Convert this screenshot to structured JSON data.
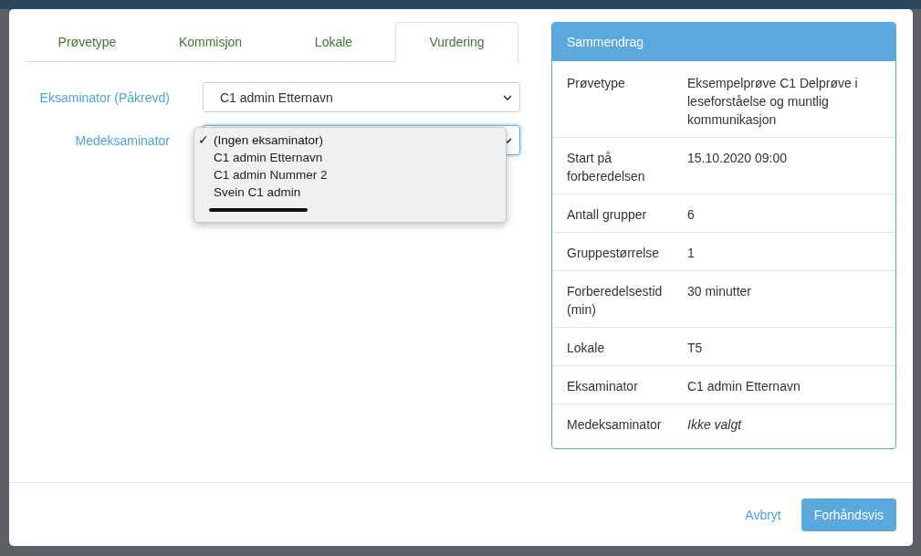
{
  "tabs": [
    {
      "label": "Prøvetype",
      "selected": false
    },
    {
      "label": "Kommisjon",
      "selected": false
    },
    {
      "label": "Lokale",
      "selected": false
    },
    {
      "label": "Vurdering",
      "selected": true
    }
  ],
  "fields": [
    {
      "label": "Eksaminator (Påkrevd)",
      "value": "C1 admin Etternavn",
      "focused": false
    },
    {
      "label": "Medeksaminator",
      "focused": true
    }
  ],
  "dropdown": {
    "options": [
      {
        "kind": "text",
        "label": "(Ingen eksaminator)",
        "selected": true,
        "check": "✓"
      },
      {
        "kind": "text",
        "label": "C1 admin Etternavn",
        "selected": false
      },
      {
        "kind": "text",
        "label": "C1 admin Nummer 2",
        "selected": false
      },
      {
        "kind": "text",
        "label": "Svein C1 admin",
        "selected": false
      },
      {
        "kind": "redacted"
      }
    ]
  },
  "summary": {
    "title": "Sammendrag",
    "rows": [
      {
        "key": "Prøvetype",
        "value": "Eksempelprøve C1 Delprøve i leseforståelse og muntlig kommunikasjon",
        "italic": false
      },
      {
        "key": "Start på forberedelsen",
        "value": "15.10.2020 09:00",
        "italic": false
      },
      {
        "key": "Antall grupper",
        "value": "6",
        "italic": false
      },
      {
        "key": "Gruppestørrelse",
        "value": "1",
        "italic": false
      },
      {
        "key": "Forberedelsestid (min)",
        "value": "30 minutter",
        "italic": false
      },
      {
        "key": "Lokale",
        "value": "T5",
        "italic": false
      },
      {
        "key": "Eksaminator",
        "value": "C1 admin Etternavn",
        "italic": false
      },
      {
        "key": "Medeksaminator",
        "value": "Ikke valgt",
        "italic": true
      }
    ]
  },
  "footer": {
    "cancel": "Avbryt",
    "preview": "Forhåndsvis"
  }
}
